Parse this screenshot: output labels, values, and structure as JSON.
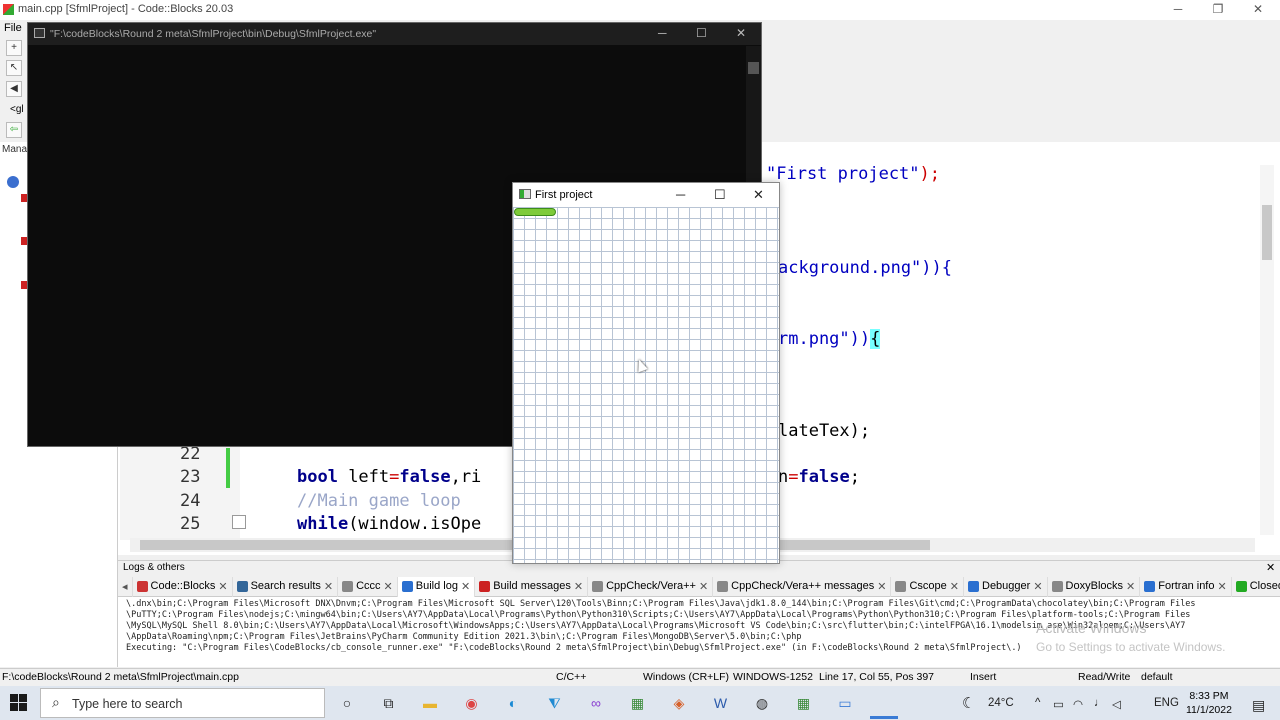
{
  "ide": {
    "title": "main.cpp [SfmlProject] - Code::Blocks 20.03",
    "menu_file": "File",
    "management_label": "Manag",
    "toolbar_glyphs": [
      "<gl"
    ]
  },
  "editor": {
    "line_numbers": [
      "22",
      "23",
      "24",
      "25"
    ],
    "line23_kw1": "bool",
    "line23_text1": " left",
    "line23_eq": "=",
    "line23_kw2": "false",
    "line23_text2": ",ri",
    "line24_comment": "//Main game loop",
    "line25_kw": "while",
    "line25_text": "(window.isOpe",
    "frag_title_str": "\"First project\"",
    "frag_title_end": ");",
    "frag_bg": "ackground.png\")){",
    "frag_platform": "rm.png\"))",
    "frag_platform_brace": "{",
    "frag_tex": "lateTex);",
    "frag_false_pre": "n",
    "frag_false_eq": "=",
    "frag_false_kw": "false",
    "frag_false_end": ";"
  },
  "console_window": {
    "title": "\"F:\\codeBlocks\\Round 2 meta\\SfmlProject\\bin\\Debug\\SfmlProject.exe\""
  },
  "sfml_window": {
    "title": "First project",
    "platform_color": "#7ecb3a"
  },
  "logs": {
    "panel_title": "Logs & others",
    "tabs": [
      {
        "label": "Code::Blocks",
        "icon": "codeblocks-icon",
        "active": false
      },
      {
        "label": "Search results",
        "icon": "search-icon",
        "active": false
      },
      {
        "label": "Cccc",
        "icon": "file-icon",
        "active": false
      },
      {
        "label": "Build log",
        "icon": "gear-icon",
        "active": true
      },
      {
        "label": "Build messages",
        "icon": "pin-icon",
        "active": false
      },
      {
        "label": "CppCheck/Vera++",
        "icon": "file-icon",
        "active": false
      },
      {
        "label": "CppCheck/Vera++ messages",
        "icon": "file-icon",
        "active": false
      },
      {
        "label": "Cscope",
        "icon": "file-icon",
        "active": false
      },
      {
        "label": "Debugger",
        "icon": "gear-icon",
        "active": false
      },
      {
        "label": "DoxyBlocks",
        "icon": "file-icon",
        "active": false
      },
      {
        "label": "Fortran info",
        "icon": "fortran-icon",
        "active": false
      },
      {
        "label": "Closed fi",
        "icon": "closed-files-icon",
        "active": false
      }
    ],
    "lines": [
      "\\.dnx\\bin;C:\\Program Files\\Microsoft DNX\\Dnvm;C:\\Program Files\\Microsoft SQL Server\\120\\Tools\\Binn;C:\\Program Files\\Java\\jdk1.8.0_144\\bin;C:\\Program Files\\Git\\cmd;C:\\ProgramData\\chocolatey\\bin;C:\\Program Files",
      "\\PuTTY;C:\\Program Files\\nodejs;C:\\mingw64\\bin;C:\\Users\\AY7\\AppData\\Local\\Programs\\Python\\Python310\\Scripts;C:\\Users\\AY7\\AppData\\Local\\Programs\\Python\\Python310;C:\\Program Files\\platform-tools;C:\\Program Files",
      "\\MySQL\\MySQL Shell 8.0\\bin;C:\\Users\\AY7\\AppData\\Local\\Microsoft\\WindowsApps;C:\\Users\\AY7\\AppData\\Local\\Programs\\Microsoft VS Code\\bin;C:\\src\\flutter\\bin;C:\\intelFPGA\\16.1\\modelsim_ase\\Win32aloem;C:\\Users\\AY7",
      "\\AppData\\Roaming\\npm;C:\\Program Files\\JetBrains\\PyCharm Community Edition 2021.3\\bin\\;C:\\Program Files\\MongoDB\\Server\\5.0\\bin;C:\\php",
      "Executing: \"C:\\Program Files\\CodeBlocks/cb_console_runner.exe\" \"F:\\codeBlocks\\Round 2 meta\\SfmlProject\\bin\\Debug\\SfmlProject.exe\"  (in F:\\codeBlocks\\Round 2 meta\\SfmlProject\\.)"
    ],
    "watermark_title": "Activate Windows",
    "watermark_sub": "Go to Settings to activate Windows."
  },
  "statusbar": {
    "path": "F:\\codeBlocks\\Round 2 meta\\SfmlProject\\main.cpp",
    "language": "C/C++",
    "line_endings": "Windows (CR+LF)",
    "encoding": "WINDOWS-1252",
    "position": "Line 17, Col 55, Pos 397",
    "mode": "Insert",
    "access": "Read/Write",
    "profile": "default"
  },
  "taskbar": {
    "search_placeholder": "Type here to search",
    "temperature": "24°C",
    "language": "ENG",
    "time": "8:33 PM",
    "date": "11/1/2022",
    "apps": [
      "cortana-icon",
      "task-view-icon",
      "file-explorer-icon",
      "chrome-icon",
      "edge-icon",
      "vscode-icon",
      "visual-studio-icon",
      "app-icon",
      "codeblocks-icon",
      "word-icon",
      "github-icon",
      "app-icon",
      "active-app-icon"
    ]
  }
}
